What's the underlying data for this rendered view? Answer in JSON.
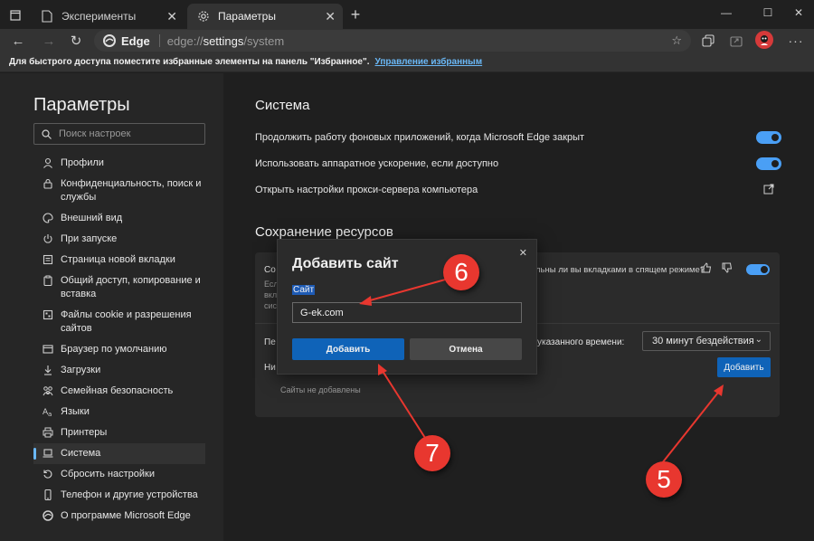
{
  "tabs": [
    {
      "label": "Эксперименты",
      "active": false
    },
    {
      "label": "Параметры",
      "active": true
    }
  ],
  "toolbar": {
    "brand": "Edge",
    "url_prefix": "edge://",
    "url_host": "settings",
    "url_path": "/system"
  },
  "favorites_bar": {
    "message": "Для быстрого доступа поместите избранные элементы на панель \"Избранное\".",
    "link": "Управление избранным"
  },
  "sidebar": {
    "title": "Параметры",
    "search_placeholder": "Поиск настроек",
    "items": [
      {
        "label": "Профили",
        "icon": "person-icon"
      },
      {
        "label": "Конфиденциальность, поиск и службы",
        "icon": "lock-icon"
      },
      {
        "label": "Внешний вид",
        "icon": "palette-icon"
      },
      {
        "label": "При запуске",
        "icon": "power-icon"
      },
      {
        "label": "Страница новой вкладки",
        "icon": "new-tab-page-icon"
      },
      {
        "label": "Общий доступ, копирование и вставка",
        "icon": "clipboard-icon"
      },
      {
        "label": "Файлы cookie и разрешения сайтов",
        "icon": "cookie-icon"
      },
      {
        "label": "Браузер по умолчанию",
        "icon": "browser-icon"
      },
      {
        "label": "Загрузки",
        "icon": "download-icon"
      },
      {
        "label": "Семейная безопасность",
        "icon": "family-icon"
      },
      {
        "label": "Языки",
        "icon": "language-icon"
      },
      {
        "label": "Принтеры",
        "icon": "printer-icon"
      },
      {
        "label": "Система",
        "icon": "laptop-icon",
        "selected": true
      },
      {
        "label": "Сбросить настройки",
        "icon": "reset-icon"
      },
      {
        "label": "Телефон и другие устройства",
        "icon": "phone-icon"
      },
      {
        "label": "О программе Microsoft Edge",
        "icon": "edge-logo-icon"
      }
    ]
  },
  "system": {
    "title": "Система",
    "rows": [
      {
        "label": "Продолжить работу фоновых приложений, когда Microsoft Edge закрыт",
        "control": "toggle",
        "on": true
      },
      {
        "label": "Использовать аппаратное ускорение, если доступно",
        "control": "toggle",
        "on": true
      },
      {
        "label": "Открыть настройки прокси-сервера компьютера",
        "control": "external-link"
      }
    ]
  },
  "resources": {
    "title": "Сохранение ресурсов",
    "card_heading_fragment": "Со",
    "card_desc_fragments": [
      "Есл",
      "вкл",
      "сис"
    ],
    "feedback_text": "льны ли вы вкладками в спящем режиме?",
    "period_label_fragment": "Пе",
    "period_label_tail": "указанного времени:",
    "period_value": "30 минут бездействия",
    "never_sleep_fragment": "Ни",
    "add_button": "Добавить",
    "empty_text": "Сайты не добавлены"
  },
  "dialog": {
    "title": "Добавить сайт",
    "field_label": "Сайт",
    "field_value": "G-ek.com",
    "ok_label": "Добавить",
    "cancel_label": "Отмена"
  },
  "callouts": [
    "6",
    "7",
    "5"
  ],
  "colors": {
    "accent": "#4a9ff5",
    "primary_button": "#0f63b8",
    "callout": "#e8372f",
    "link": "#6ab8f7"
  }
}
